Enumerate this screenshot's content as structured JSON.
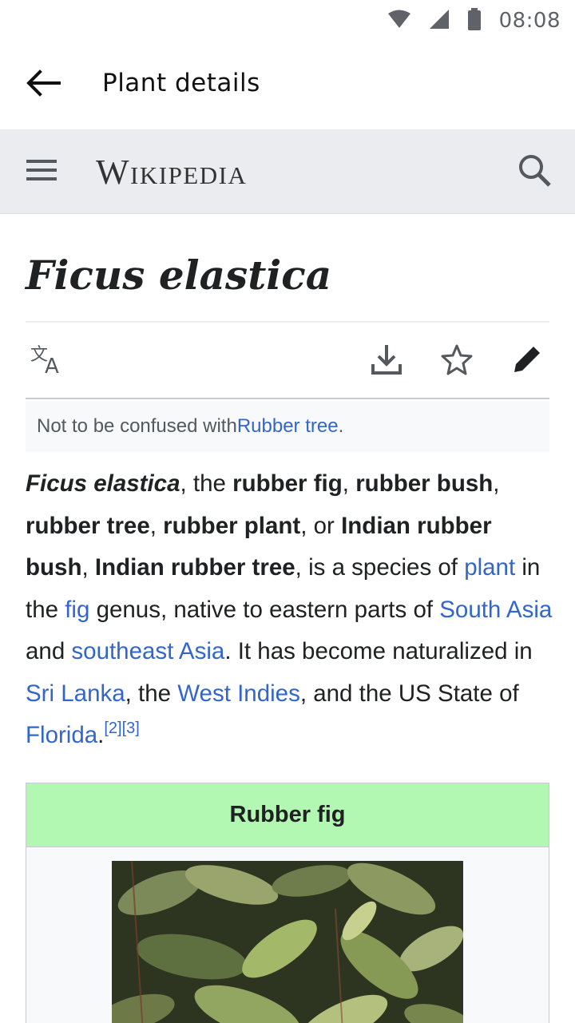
{
  "status_bar": {
    "time": "08:08",
    "icons": [
      "wifi-icon",
      "cellular-signal-icon",
      "battery-icon"
    ]
  },
  "app_bar": {
    "back_icon": "arrow-left-icon",
    "title": "Plant details"
  },
  "wiki_header": {
    "menu_icon": "hamburger-menu-icon",
    "logo_text": "Wikipedia",
    "search_icon": "search-icon"
  },
  "article": {
    "title": "Ficus elastica",
    "actions": [
      "language-icon",
      "download-icon",
      "star-icon",
      "edit-pencil-icon"
    ],
    "hatnote": {
      "prefix": "Not to be confused with ",
      "link": "Rubber tree",
      "suffix": "."
    },
    "intro": {
      "t1": "Ficus elastica",
      "t2": ", the ",
      "t3": "rubber fig",
      "t4": ", ",
      "t5": "rubber bush",
      "t6": ", ",
      "t7": "rubber tree",
      "t8": ", ",
      "t9": "rubber plant",
      "t10": ", or ",
      "t11": "Indian rubber bush",
      "t12": ", ",
      "t13": "Indian rubber tree",
      "t14": ", is a species of ",
      "l1": "plant",
      "t15": " in the ",
      "l2": "fig",
      "t16": " genus, native to eastern parts of ",
      "l3": "South Asia",
      "t17": " and ",
      "l4": "southeast Asia",
      "t18": ". It has become naturalized in ",
      "l5": "Sri Lanka",
      "t19": ", the ",
      "l6": "West Indies",
      "t20": ", and the US State of ",
      "l7": "Florida",
      "t21": ".",
      "ref": "[2][3]"
    },
    "infobox": {
      "heading": "Rubber fig",
      "image_alt": "rubber-fig-leaves-photo"
    }
  },
  "colors": {
    "link": "#3366cc",
    "infobox_header": "#b2f7b2",
    "wiki_header_bg": "#eaecf0"
  }
}
